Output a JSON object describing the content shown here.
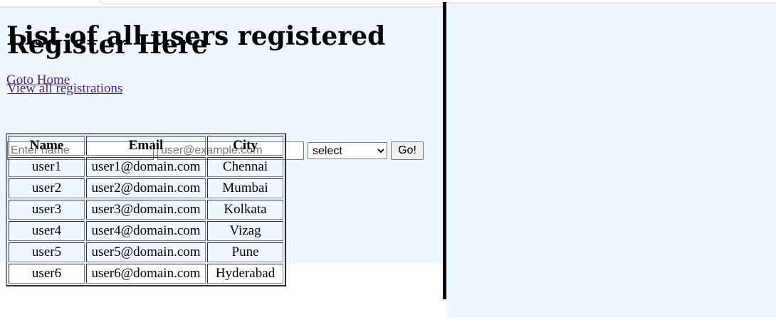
{
  "left": {
    "title": "Register Here",
    "link": "View all registrations",
    "form": {
      "name_placeholder": "Enter name",
      "email_placeholder": "user@example.com",
      "city_select": "select",
      "submit_label": "Go!"
    }
  },
  "right": {
    "title": "List of all users registered",
    "link": "Goto Home",
    "table": {
      "headers": [
        "Name",
        "Email",
        "City"
      ],
      "rows": [
        [
          "user1",
          "user1@domain.com",
          "Chennai"
        ],
        [
          "user2",
          "user2@domain.com",
          "Mumbai"
        ],
        [
          "user3",
          "user3@domain.com",
          "Kolkata"
        ],
        [
          "user4",
          "user4@domain.com",
          "Vizag"
        ],
        [
          "user5",
          "user5@domain.com",
          "Pune"
        ],
        [
          "user6",
          "user6@domain.com",
          "Hyderabad"
        ]
      ]
    }
  },
  "colors": {
    "pane_background": "#eef6ff",
    "link_visited": "#551a8b",
    "divider": "#000000"
  }
}
